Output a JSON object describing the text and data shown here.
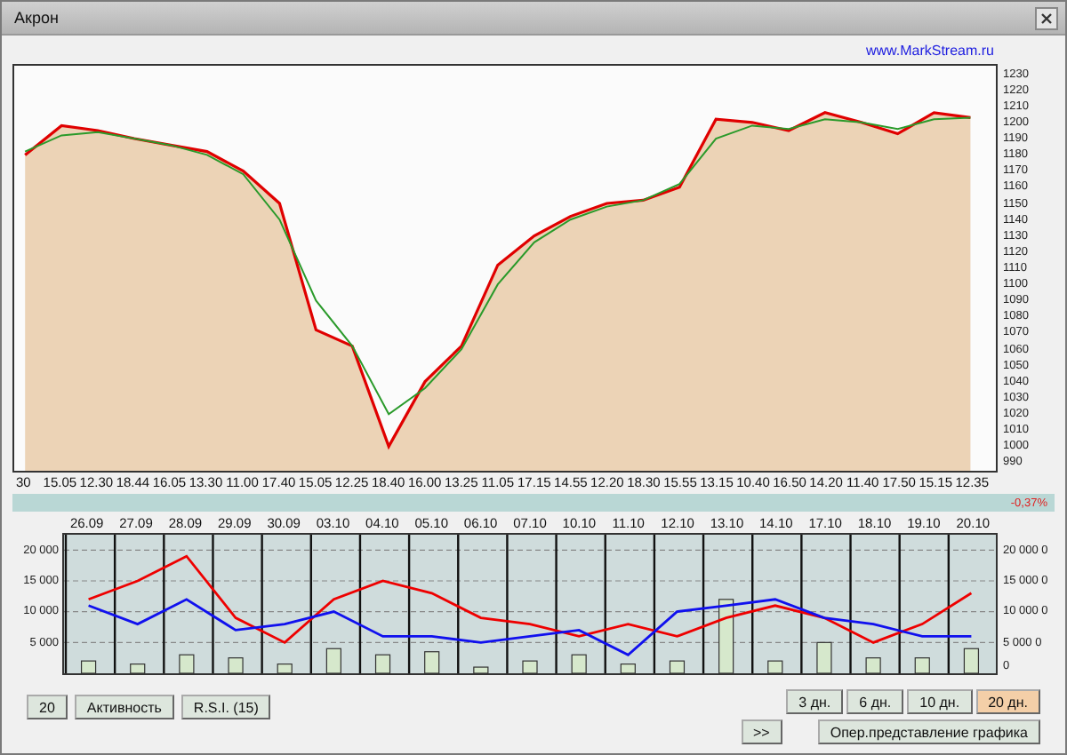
{
  "window": {
    "title": "Акрон"
  },
  "link": "www.MarkStream.ru",
  "price_chart": {
    "chart_data": {
      "type": "area",
      "categories": [
        "30",
        "15.05",
        "12.30",
        "18.44",
        "16.05",
        "13.30",
        "11.00",
        "17.40",
        "15.05",
        "12.25",
        "18.40",
        "16.00",
        "13.25",
        "11.05",
        "17.15",
        "14.55",
        "12.20",
        "18.30",
        "15.55",
        "13.15",
        "10.40",
        "16.50",
        "14.20",
        "11.40",
        "17.50",
        "15.15",
        "12.35"
      ],
      "series": [
        {
          "color": "#e00000",
          "values": [
            1180,
            1198,
            1195,
            1190,
            1186,
            1182,
            1170,
            1150,
            1072,
            1062,
            1000,
            1040,
            1062,
            1112,
            1130,
            1142,
            1150,
            1152,
            1160,
            1202,
            1200,
            1195,
            1206,
            1200,
            1193,
            1206,
            1203
          ]
        },
        {
          "type": "line",
          "color": "#2a9a2a",
          "values": [
            1182,
            1192,
            1194,
            1190,
            1186,
            1180,
            1168,
            1140,
            1090,
            1062,
            1020,
            1036,
            1060,
            1100,
            1126,
            1140,
            1148,
            1152,
            1162,
            1190,
            1198,
            1196,
            1202,
            1200,
            1196,
            1202,
            1203
          ]
        }
      ],
      "ylim": [
        985,
        1235
      ],
      "yticks": [
        990,
        1000,
        1010,
        1020,
        1030,
        1040,
        1050,
        1060,
        1070,
        1080,
        1090,
        1100,
        1110,
        1120,
        1130,
        1140,
        1150,
        1160,
        1170,
        1180,
        1190,
        1200,
        1210,
        1220,
        1230
      ]
    }
  },
  "change": "-0,37%",
  "activity_chart": {
    "chart_data": {
      "type": "line",
      "categories": [
        "26.09",
        "27.09",
        "28.09",
        "29.09",
        "30.09",
        "03.10",
        "04.10",
        "05.10",
        "06.10",
        "07.10",
        "10.10",
        "11.10",
        "12.10",
        "13.10",
        "14.10",
        "17.10",
        "18.10",
        "19.10",
        "20.10"
      ],
      "grid": true,
      "series": [
        {
          "color": "#ee0000",
          "values": [
            12000,
            15000,
            19000,
            9000,
            5000,
            12000,
            15000,
            13000,
            9000,
            8000,
            6000,
            8000,
            6000,
            9000,
            11000,
            9000,
            5000,
            8000,
            13000
          ]
        },
        {
          "color": "#1010ee",
          "values": [
            11000,
            8000,
            12000,
            7000,
            8000,
            10000,
            6000,
            6000,
            5000,
            6000,
            7000,
            3000,
            10000,
            11000,
            12000,
            9000,
            8000,
            6000,
            6000
          ]
        },
        {
          "type": "bar",
          "color": "#d6e8cc",
          "values": [
            2000,
            1500,
            3000,
            2500,
            1500,
            4000,
            3000,
            3500,
            1000,
            2000,
            3000,
            1500,
            2000,
            12000,
            2000,
            5000,
            2500,
            2500,
            4000
          ]
        }
      ],
      "ylim": [
        0,
        22500
      ],
      "yticks": [
        {
          "value": 5000,
          "label": "5 000"
        },
        {
          "value": 10000,
          "label": "10 000"
        },
        {
          "value": 15000,
          "label": "15 000"
        },
        {
          "value": 20000,
          "label": "20 000"
        }
      ]
    },
    "right_ticks": [
      "20 000 0",
      "15 000 0",
      "10 000 0",
      "5 000 0",
      "0"
    ]
  },
  "indicator_buttons": [
    "20",
    "Активность",
    "R.S.I. (15)"
  ],
  "periods": [
    {
      "label": "3 дн.",
      "selected": false
    },
    {
      "label": "6 дн.",
      "selected": false
    },
    {
      "label": "10 дн.",
      "selected": false
    },
    {
      "label": "20 дн.",
      "selected": true
    }
  ],
  "scroll_button": ">>",
  "view_button": "Опер.представление графика"
}
